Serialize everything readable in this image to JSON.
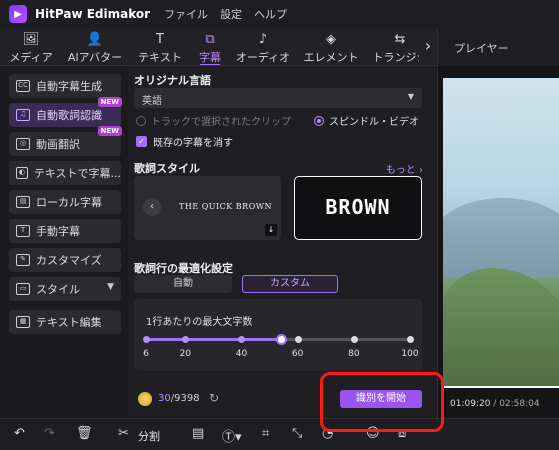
{
  "app": {
    "title": "HitPaw Edimakor",
    "menu": [
      "ファイル",
      "設定",
      "ヘルプ"
    ]
  },
  "tabs": [
    {
      "label": "メディア",
      "icon": "media-icon",
      "glyph": "🖼",
      "active": false
    },
    {
      "label": "AIアバター",
      "icon": "ai-avatar-icon",
      "glyph": "👤",
      "active": false
    },
    {
      "label": "テキスト",
      "icon": "text-icon",
      "glyph": "T",
      "active": false
    },
    {
      "label": "字幕",
      "icon": "subtitle-icon",
      "glyph": "⧉",
      "active": true
    },
    {
      "label": "オーディオ",
      "icon": "audio-icon",
      "glyph": "♪",
      "active": false
    },
    {
      "label": "エレメント",
      "icon": "element-icon",
      "glyph": "◈",
      "active": false
    },
    {
      "label": "トランジシ",
      "icon": "transition-icon",
      "glyph": "⇆",
      "active": false
    }
  ],
  "player": {
    "title": "プレイヤー",
    "current_time": "01:09:20",
    "total_time": "02:58:04"
  },
  "sidebar": {
    "items": [
      {
        "label": "自動字幕生成",
        "icon": "cc-icon",
        "glyph": "CC",
        "active": false,
        "new": false
      },
      {
        "label": "自動歌詞認識",
        "icon": "lyrics-icon",
        "glyph": "♫",
        "active": true,
        "new": true
      },
      {
        "label": "動画翻訳",
        "icon": "translate-icon",
        "glyph": "◎",
        "active": false,
        "new": true
      },
      {
        "label": "テキストで字幕...",
        "icon": "text-to-subtitle-icon",
        "glyph": "◐",
        "active": false,
        "new": false
      },
      {
        "label": "ローカル字幕",
        "icon": "local-subtitle-icon",
        "glyph": "▤",
        "active": false,
        "new": false
      },
      {
        "label": "手動字幕",
        "icon": "manual-subtitle-icon",
        "glyph": "T",
        "active": false,
        "new": false
      },
      {
        "label": "カスタマイズ",
        "icon": "customize-icon",
        "glyph": "✎",
        "active": false,
        "new": false
      },
      {
        "label": "スタイル",
        "icon": "style-icon",
        "glyph": "▭",
        "active": false,
        "new": false,
        "dropdown": true
      },
      {
        "label": "テキスト編集",
        "icon": "text-edit-icon",
        "glyph": "▦",
        "active": false,
        "new": false
      }
    ],
    "new_badge": "NEW"
  },
  "panel": {
    "language_title": "オリジナル言語",
    "language_value": "英語",
    "radio_track": "トラックで選択されたクリップ",
    "radio_spindle": "スピンドル・ビデオ",
    "checkbox_label": "既存の字幕を消す",
    "lyrics_style_title": "歌詞スタイル",
    "more_label": "もっと",
    "style_sample_1": "THE QUICK BROWN",
    "style_sample_2": "BROWN",
    "optimize_title": "歌詞行の最適化設定",
    "seg_auto": "自動",
    "seg_custom": "カスタム",
    "slider_title": "1行あたりの最大文字数",
    "slider_ticks": [
      "6",
      "20",
      "40",
      "60",
      "80",
      "100"
    ],
    "slider_value": 54,
    "credits_used": "30",
    "credits_total": "/9398",
    "start_button": "識別を開始"
  },
  "bottombar": {
    "split_label": "分割"
  }
}
